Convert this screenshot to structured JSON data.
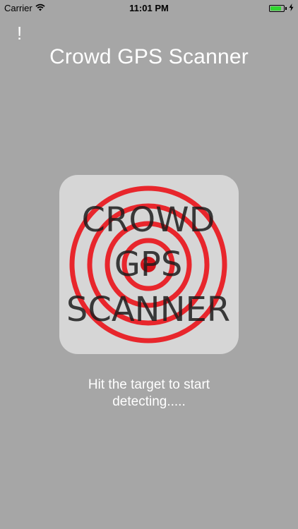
{
  "status_bar": {
    "carrier": "Carrier",
    "time": "11:01 PM",
    "wifi_icon": "wifi-icon",
    "battery_icon": "battery-icon",
    "charging_icon": "charging-bolt-icon",
    "battery_color": "#2fd62f",
    "battery_level": 0.85
  },
  "header": {
    "alert_label": "!",
    "title": "Crowd GPS Scanner"
  },
  "target": {
    "logo_line1": "CROWD",
    "logo_line2": "GPS",
    "logo_line3": "SCANNER",
    "ring_color": "#e8262c",
    "center_color": "#d4141c",
    "background_color": "#d6d6d6"
  },
  "hint": {
    "line1": "Hit the target to start",
    "line2": "detecting....."
  }
}
